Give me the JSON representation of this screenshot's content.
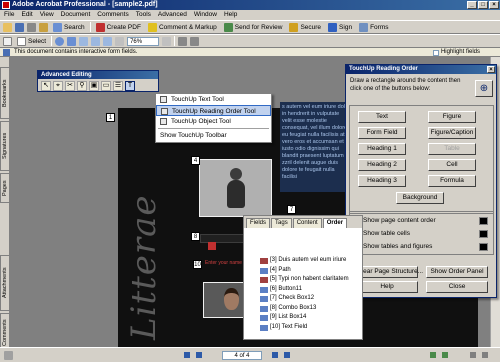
{
  "window": {
    "title": "Adobe Acrobat Professional - [sample2.pdf]",
    "controls": [
      "_",
      "□",
      "×"
    ]
  },
  "menu": [
    "File",
    "Edit",
    "View",
    "Document",
    "Comments",
    "Tools",
    "Advanced",
    "Window",
    "Help"
  ],
  "toolbar1": {
    "open": "",
    "search": "Search",
    "create_pdf": "Create PDF",
    "comment_markup": "Comment & Markup",
    "send_review": "Send for Review",
    "secure": "Secure",
    "sign": "Sign",
    "forms": "Forms"
  },
  "toolbar2": {
    "select": "Select",
    "zoom": "76%"
  },
  "formbar": {
    "message": "This document contains interactive form fields.",
    "highlight": "Highlight fields"
  },
  "sidetabs": {
    "bookmarks": "Bookmarks",
    "signatures": "Signatures",
    "pages": "Pages",
    "attachments": "Attachments",
    "comments": "Comments"
  },
  "adv_edit": {
    "title": "Advanced Editing"
  },
  "context_menu": {
    "items": [
      "TouchUp Text Tool",
      "TouchUp Reading Order Tool",
      "TouchUp Object Tool",
      "Show TouchUp Toolbar"
    ]
  },
  "document": {
    "title_text": "Litterae",
    "blue_text": "s autem vel eum iriure dolor in hendrerit in vulputate velit esse molestie consequat, vel illum dolore eu feugiat nulla facilisis at vero eros et accumsan et iusto odio dignissim qui blandit praesent luptatum zzril delenit augue duis dolore te feugait nulla facilisi",
    "markers": [
      "1",
      "4",
      "7",
      "8",
      "10"
    ],
    "field_label": "Enter your name"
  },
  "touchup_panel": {
    "title": "TouchUp Reading Order",
    "instructions": "Draw a rectangle around the content then click one of the buttons below:",
    "buttons": {
      "text": "Text",
      "figure": "Figure",
      "form_field": "Form Field",
      "figure_caption": "Figure/Caption",
      "heading1": "Heading 1",
      "table": "Table",
      "heading2": "Heading 2",
      "cell": "Cell",
      "heading3": "Heading 3",
      "formula": "Formula",
      "background": "Background"
    },
    "options": {
      "show_page_order": "Show page content order",
      "show_table_cells": "Show table cells",
      "show_tables_figures": "Show tables and figures"
    },
    "footer": {
      "clear": "Clear Page Structure...",
      "show_order": "Show Order Panel",
      "help": "Help",
      "close": "Close"
    }
  },
  "order_panel": {
    "tabs": [
      "Fields",
      "Tags",
      "Content",
      "Order"
    ],
    "items": [
      "[3] Duis autem vel eum iriure",
      "[4] Path",
      "[5] Typi non habent claritatem",
      "[6] Button11",
      "[7] Check Box12",
      "[8] Combo Box13",
      "[9] List Box14",
      "[10] Text Field"
    ]
  },
  "status": {
    "page": "4 of 4"
  }
}
